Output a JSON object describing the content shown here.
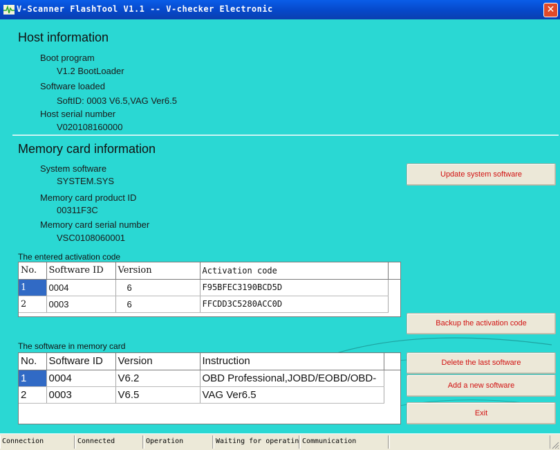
{
  "window": {
    "title": "V-Scanner FlashTool V1.1 -- V-checker Electronic"
  },
  "host": {
    "heading": "Host information",
    "boot_label": "Boot program",
    "boot_value": "V1.2 BootLoader",
    "software_label": "Software loaded",
    "software_value": "SoftID: 0003 V6.5,VAG Ver6.5",
    "serial_label": "Host serial number",
    "serial_value": "V020108160000"
  },
  "memory": {
    "heading": "Memory card information",
    "system_label": "System software",
    "system_value": "SYSTEM.SYS",
    "product_label": "Memory card product ID",
    "product_value": "00311F3C",
    "serial_label": "Memory card serial number",
    "serial_value": "VSC0108060001"
  },
  "activation": {
    "caption": "The entered activation code",
    "headers": {
      "no": "No.",
      "id": "Software ID",
      "version": "Version",
      "code": "Activation code"
    },
    "rows": [
      {
        "no": "1",
        "id": "0004",
        "version": "6",
        "code": "F95BFEC3190BCD5D"
      },
      {
        "no": "2",
        "id": "0003",
        "version": "6",
        "code": "FFCDD3C5280ACC0D"
      }
    ]
  },
  "software": {
    "caption": "The software in memory card",
    "headers": {
      "no": "No.",
      "id": "Software ID",
      "version": "Version",
      "instruction": "Instruction"
    },
    "rows": [
      {
        "no": "1",
        "id": "0004",
        "version": "V6.2",
        "instruction": "OBD Professional,JOBD/EOBD/OBD-"
      },
      {
        "no": "2",
        "id": "0003",
        "version": "V6.5",
        "instruction": "VAG Ver6.5"
      }
    ]
  },
  "buttons": {
    "update": "Update system software",
    "backup": "Backup the activation code",
    "delete": "Delete the last software",
    "add": "Add a new software",
    "exit": "Exit"
  },
  "status": {
    "connection_label": "Connection",
    "connection_value": "Connected",
    "operation_label": "Operation",
    "operation_value": "Waiting for operating...",
    "communication_label": "Communication",
    "communication_value": ""
  },
  "colors": {
    "background": "#2ad8d3",
    "titlebar": "#0648c9",
    "button_text": "#d11010",
    "selection": "#316ac5"
  }
}
